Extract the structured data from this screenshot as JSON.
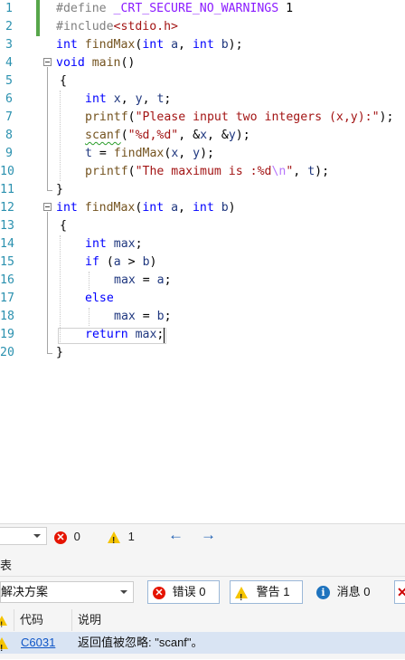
{
  "editor": {
    "lines": [
      {
        "n": "1",
        "tokens": [
          [
            "pp",
            "#define "
          ],
          [
            "macro",
            "_CRT_SECURE_NO_WARNINGS"
          ],
          [
            "",
            ""
          ],
          [
            "plain",
            " 1"
          ]
        ]
      },
      {
        "n": "2",
        "tokens": [
          [
            "pp",
            "#include"
          ],
          [
            "str",
            "<stdio.h>"
          ]
        ]
      },
      {
        "n": "3",
        "tokens": [
          [
            "kw",
            "int"
          ],
          [
            "plain",
            " "
          ],
          [
            "fn",
            "findMax"
          ],
          [
            "plain",
            "("
          ],
          [
            "kw",
            "int"
          ],
          [
            "plain",
            " "
          ],
          [
            "var",
            "a"
          ],
          [
            "plain",
            ", "
          ],
          [
            "kw",
            "int"
          ],
          [
            "plain",
            " "
          ],
          [
            "var",
            "b"
          ],
          [
            "plain",
            ");"
          ]
        ]
      },
      {
        "n": "4",
        "tokens": [
          [
            "kw",
            "void"
          ],
          [
            "plain",
            " "
          ],
          [
            "fn",
            "main"
          ],
          [
            "plain",
            "()"
          ]
        ]
      },
      {
        "n": "5",
        "tokens": [
          [
            "plain",
            "{"
          ]
        ]
      },
      {
        "n": "6",
        "tokens": [
          [
            "kw",
            "int"
          ],
          [
            "plain",
            " "
          ],
          [
            "var",
            "x"
          ],
          [
            "plain",
            ", "
          ],
          [
            "var",
            "y"
          ],
          [
            "plain",
            ", "
          ],
          [
            "var",
            "t"
          ],
          [
            "plain",
            ";"
          ]
        ]
      },
      {
        "n": "7",
        "tokens": [
          [
            "fn",
            "printf"
          ],
          [
            "plain",
            "("
          ],
          [
            "str",
            "\"Please input two integers (x,y):\""
          ],
          [
            "plain",
            ");"
          ]
        ]
      },
      {
        "n": "8",
        "tokens": [
          [
            "fnsq",
            "scanf"
          ],
          [
            "plain",
            "("
          ],
          [
            "str",
            "\"%d,%d\""
          ],
          [
            "plain",
            ", &"
          ],
          [
            "var",
            "x"
          ],
          [
            "plain",
            ", &"
          ],
          [
            "var",
            "y"
          ],
          [
            "plain",
            ");"
          ]
        ]
      },
      {
        "n": "9",
        "tokens": [
          [
            "var",
            "t"
          ],
          [
            "plain",
            " = "
          ],
          [
            "fn",
            "findMax"
          ],
          [
            "plain",
            "("
          ],
          [
            "var",
            "x"
          ],
          [
            "plain",
            ", "
          ],
          [
            "var",
            "y"
          ],
          [
            "plain",
            ");"
          ]
        ]
      },
      {
        "n": "10",
        "tokens": [
          [
            "fn",
            "printf"
          ],
          [
            "plain",
            "("
          ],
          [
            "str",
            "\"The maximum is :%d"
          ],
          [
            "esc",
            "\\n"
          ],
          [
            "str",
            "\""
          ],
          [
            "plain",
            ", "
          ],
          [
            "var",
            "t"
          ],
          [
            "plain",
            ");"
          ]
        ]
      },
      {
        "n": "11",
        "tokens": [
          [
            "plain",
            "}"
          ]
        ]
      },
      {
        "n": "12",
        "tokens": [
          [
            "kw",
            "int"
          ],
          [
            "plain",
            " "
          ],
          [
            "fn",
            "findMax"
          ],
          [
            "plain",
            "("
          ],
          [
            "kw",
            "int"
          ],
          [
            "plain",
            " "
          ],
          [
            "var",
            "a"
          ],
          [
            "plain",
            ", "
          ],
          [
            "kw",
            "int"
          ],
          [
            "plain",
            " "
          ],
          [
            "var",
            "b"
          ],
          [
            "plain",
            ")"
          ]
        ]
      },
      {
        "n": "13",
        "tokens": [
          [
            "plain",
            "{"
          ]
        ]
      },
      {
        "n": "14",
        "tokens": [
          [
            "kw",
            "int"
          ],
          [
            "plain",
            " "
          ],
          [
            "var",
            "max"
          ],
          [
            "plain",
            ";"
          ]
        ]
      },
      {
        "n": "15",
        "tokens": [
          [
            "kw",
            "if"
          ],
          [
            "plain",
            " ("
          ],
          [
            "var",
            "a"
          ],
          [
            "plain",
            " > "
          ],
          [
            "var",
            "b"
          ],
          [
            "plain",
            ")"
          ]
        ]
      },
      {
        "n": "16",
        "tokens": [
          [
            "var",
            "max"
          ],
          [
            "plain",
            " = "
          ],
          [
            "var",
            "a"
          ],
          [
            "plain",
            ";"
          ]
        ]
      },
      {
        "n": "17",
        "tokens": [
          [
            "kw",
            "else"
          ]
        ]
      },
      {
        "n": "18",
        "tokens": [
          [
            "var",
            "max"
          ],
          [
            "plain",
            " = "
          ],
          [
            "var",
            "b"
          ],
          [
            "plain",
            ";"
          ]
        ]
      },
      {
        "n": "19",
        "tokens": [
          [
            "kw",
            "return"
          ],
          [
            "plain",
            " "
          ],
          [
            "var",
            "max"
          ],
          [
            "plain",
            ";"
          ]
        ]
      },
      {
        "n": "20",
        "tokens": [
          [
            "plain",
            "}"
          ]
        ]
      }
    ]
  },
  "statusbar": {
    "errors": "0",
    "warnings": "1",
    "back_icon": "arrow-left-icon",
    "forward_icon": "arrow-right-icon"
  },
  "error_list": {
    "title_fragment": "表",
    "scope_value": "解决方案",
    "errors_label": "错误 0",
    "warnings_label": "警告 1",
    "messages_label": "消息 0",
    "columns": {
      "code": "代码",
      "description": "说明"
    },
    "rows": [
      {
        "code": "C6031",
        "description": "返回值被忽略: \"scanf\"。"
      }
    ]
  },
  "colors": {
    "keyword": "#0000ff",
    "string": "#a31515",
    "function": "#74531f",
    "variable": "#1f377f",
    "preprocessor": "#808080",
    "line_number": "#2b91af",
    "selected_row": "#d9e4f3"
  }
}
